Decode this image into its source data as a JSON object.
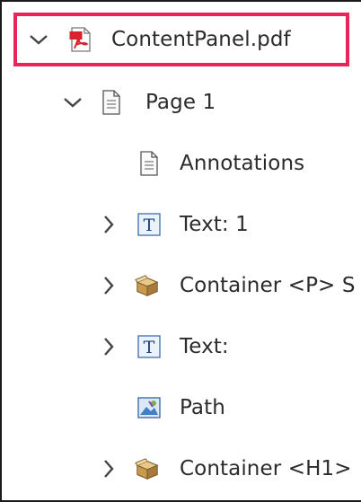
{
  "tree": {
    "root": {
      "label": "ContentPanel.pdf",
      "icon": "pdf-file-icon",
      "expanded": true,
      "highlight_color": "#e8245a"
    },
    "page": {
      "label": "Page 1",
      "icon": "page-icon",
      "expanded": true
    },
    "items": [
      {
        "label": "Annotations",
        "icon": "page-icon",
        "expandable": false
      },
      {
        "label": "Text:  1",
        "icon": "text-T-icon",
        "expandable": true
      },
      {
        "label": "Container <P> S",
        "icon": "container-box-icon",
        "expandable": true
      },
      {
        "label": "Text:",
        "icon": "text-T-icon",
        "expandable": true
      },
      {
        "label": "Path",
        "icon": "path-image-icon",
        "expandable": false
      },
      {
        "label": "Container <H1>",
        "icon": "container-box-icon",
        "expandable": true
      }
    ]
  }
}
